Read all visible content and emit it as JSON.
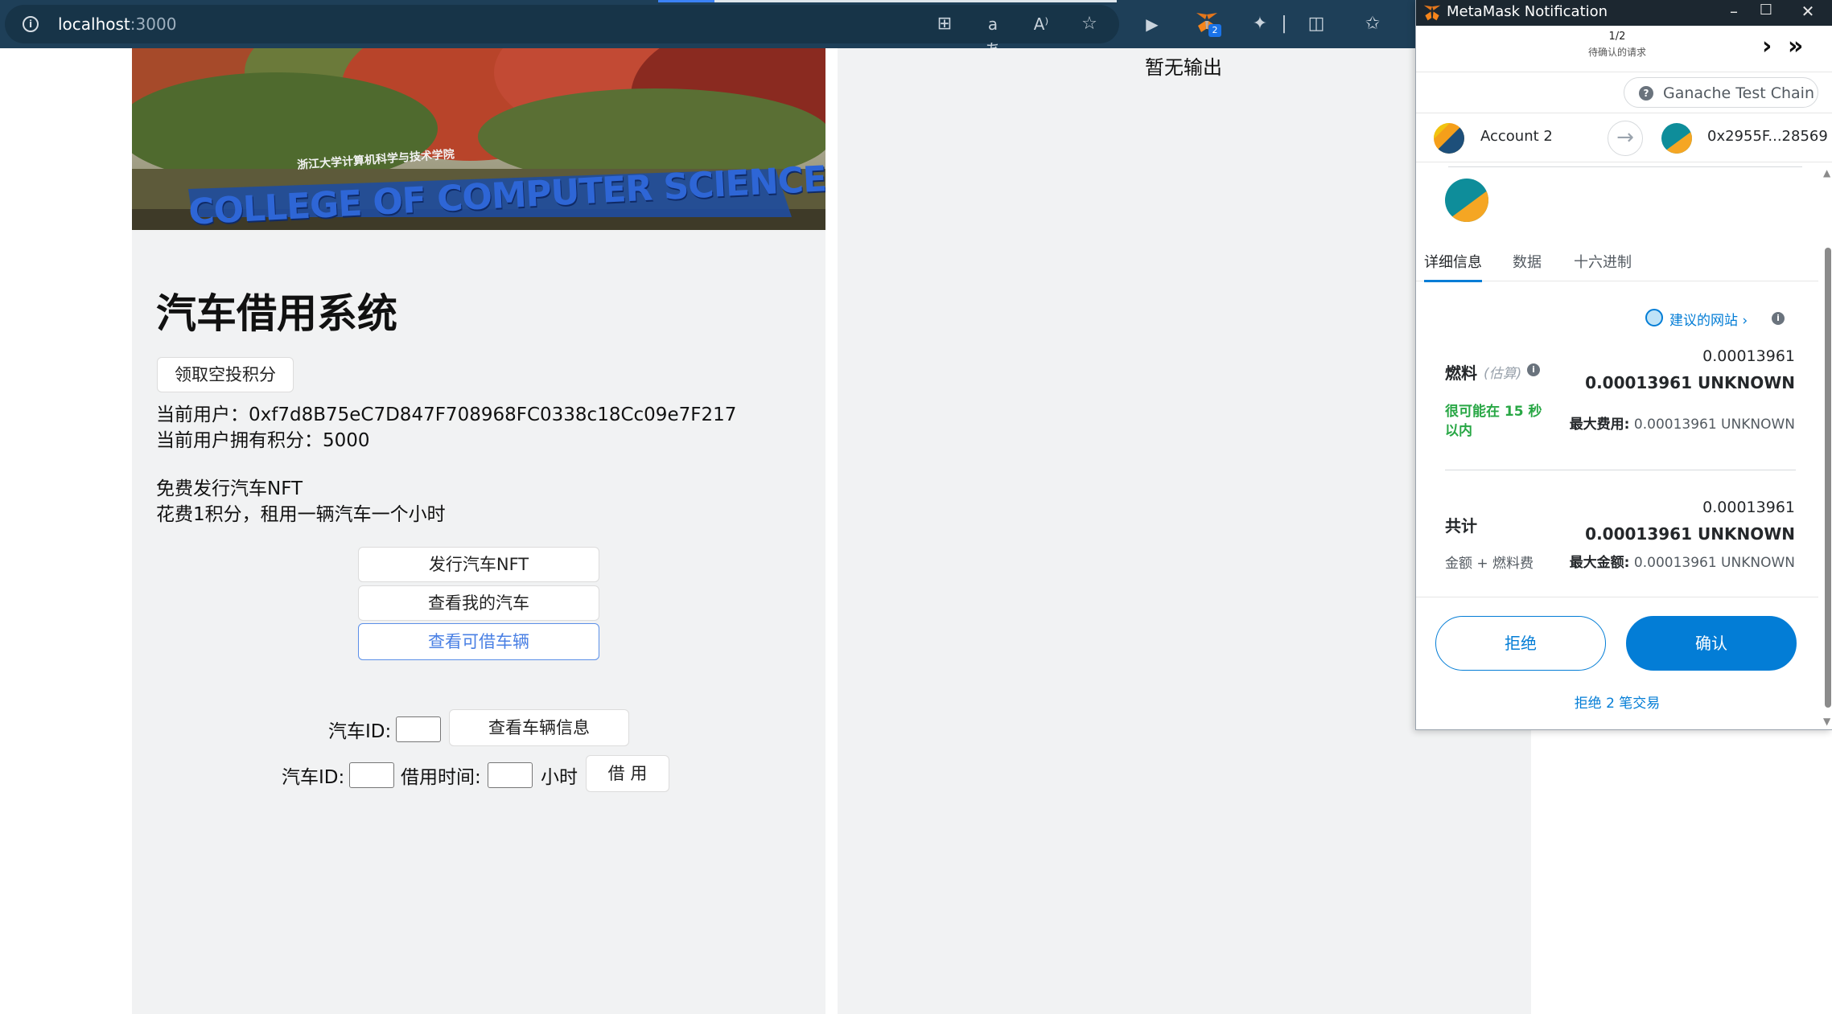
{
  "browser": {
    "url_host": "localhost",
    "url_port": ":3000",
    "extension_badge": "2"
  },
  "app": {
    "banner_text": "COLLEGE OF COMPUTER SCIENCE",
    "banner_subtext": "浙江大学计算机科学与技术学院",
    "title": "汽车借用系统",
    "airdrop_button": "领取空投积分",
    "current_user_label": "当前用户：",
    "current_user_value": "0xf7d8B75eC7D847F708968FC0338c18Cc09e7F217",
    "points_label": "当前用户拥有积分：",
    "points_value": "5000",
    "info_line1": "免费发行汽车NFT",
    "info_line2": "花费1积分，租用一辆汽车一个小时",
    "issue_button": "发行汽车NFT",
    "my_cars_button": "查看我的汽车",
    "available_button": "查看可借车辆",
    "car_id_label": "汽车ID:",
    "car_info_button": "查看车辆信息",
    "borrow_car_id_label": "汽车ID:",
    "borrow_time_label": "借用时间:",
    "hours_label": "小时",
    "borrow_button": "借 用",
    "output_text": "暂无输出"
  },
  "metamask": {
    "window_title": "MetaMask Notification",
    "counter": "1/2",
    "pending_label": "待确认的请求",
    "network": "Ganache Test Chain",
    "from_account": "Account 2",
    "to_address": "0x2955F...28569",
    "tabs": [
      "详细信息",
      "数据",
      "十六进制"
    ],
    "suggested_site": "建议的网站",
    "gas_label": "燃料",
    "gas_estimate": "(估算)",
    "gas_amount_small": "0.00013961",
    "gas_amount_large": "0.00013961 UNKNOWN",
    "likely_in": "很可能在 15 秒以内",
    "max_fee_label": "最大费用:",
    "max_fee_value": "0.00013961 UNKNOWN",
    "total_label": "共计",
    "total_amount_small": "0.00013961",
    "total_amount_large": "0.00013961 UNKNOWN",
    "total_sub": "金额 + 燃料费",
    "max_amount_label": "最大金额:",
    "max_amount_value": "0.00013961 UNKNOWN",
    "reject_button": "拒绝",
    "confirm_button": "确认",
    "reject_all": "拒绝 2 笔交易"
  },
  "colors": {
    "toolbar": "#1e3f58",
    "metamask_blue": "#037dd6",
    "success_green": "#28a745",
    "panel_bg": "#f1f2f3"
  }
}
